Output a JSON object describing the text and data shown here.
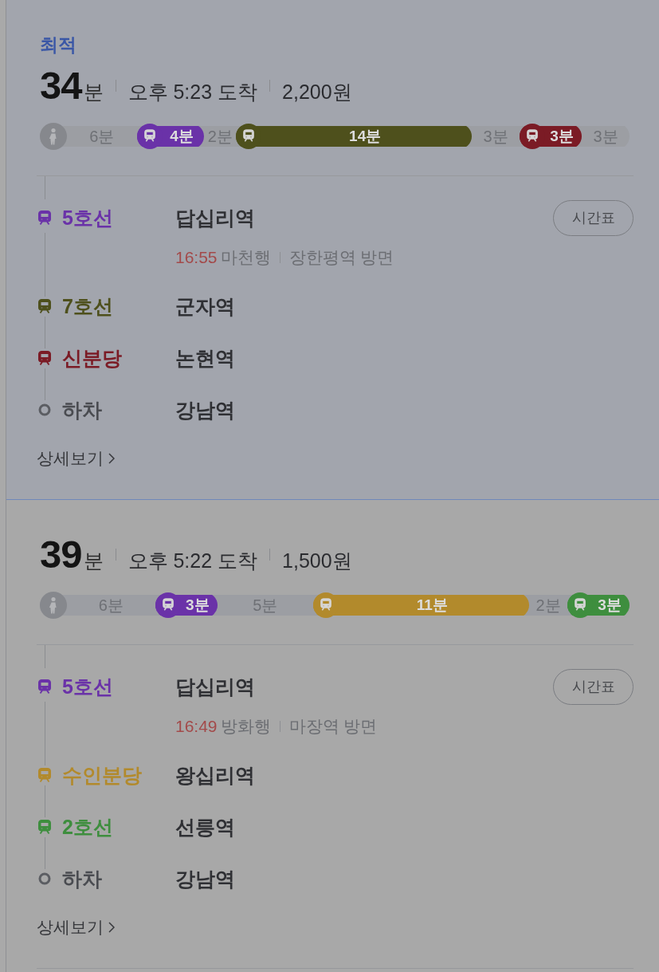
{
  "routes": [
    {
      "selected": true,
      "tag": "최적",
      "duration": "34",
      "duration_unit": "분",
      "arrival": "오후 5:23 도착",
      "fare": "2,200원",
      "bar": [
        {
          "kind": "walk",
          "text": "6분"
        },
        {
          "kind": "subway",
          "text": "4분",
          "color": "#6a32a8"
        },
        {
          "kind": "walk",
          "text": "2분"
        },
        {
          "kind": "subway",
          "text": "14분",
          "color": "#4e501c"
        },
        {
          "kind": "walk",
          "text": "3분"
        },
        {
          "kind": "subway",
          "text": "3분",
          "color": "#7b1b25"
        },
        {
          "kind": "walk",
          "text": "3분"
        }
      ],
      "steps": [
        {
          "kind": "subway",
          "label": "5호선",
          "color": "#6a32a8",
          "station": "답십리역",
          "departure": {
            "time": "16:55",
            "destination": "마천행",
            "direction": "장한평역 방면"
          },
          "button": "시간표"
        },
        {
          "kind": "subway",
          "label": "7호선",
          "color": "#4e501c",
          "station": "군자역"
        },
        {
          "kind": "subway",
          "label": "신분당",
          "color": "#7b1b25",
          "station": "논현역"
        },
        {
          "kind": "alight",
          "label": "하차",
          "station": "강남역"
        }
      ],
      "details_link": "상세보기"
    },
    {
      "selected": false,
      "duration": "39",
      "duration_unit": "분",
      "arrival": "오후 5:22 도착",
      "fare": "1,500원",
      "bar": [
        {
          "kind": "walk",
          "text": "6분"
        },
        {
          "kind": "subway",
          "text": "3분",
          "color": "#6a32a8"
        },
        {
          "kind": "walk",
          "text": "5분"
        },
        {
          "kind": "subway",
          "text": "11분",
          "color": "#b28a2c"
        },
        {
          "kind": "walk",
          "text": "2분"
        },
        {
          "kind": "subway",
          "text": "3분",
          "color": "#3e8e3e"
        }
      ],
      "steps": [
        {
          "kind": "subway",
          "label": "5호선",
          "color": "#6a32a8",
          "station": "답십리역",
          "departure": {
            "time": "16:49",
            "destination": "방화행",
            "direction": "마장역 방면"
          },
          "button": "시간표"
        },
        {
          "kind": "subway",
          "label": "수인분당",
          "color": "#b28a2c",
          "station": "왕십리역"
        },
        {
          "kind": "subway",
          "label": "2호선",
          "color": "#3e8e3e",
          "station": "선릉역"
        },
        {
          "kind": "alight",
          "label": "하차",
          "station": "강남역"
        }
      ],
      "details_link": "상세보기"
    }
  ]
}
